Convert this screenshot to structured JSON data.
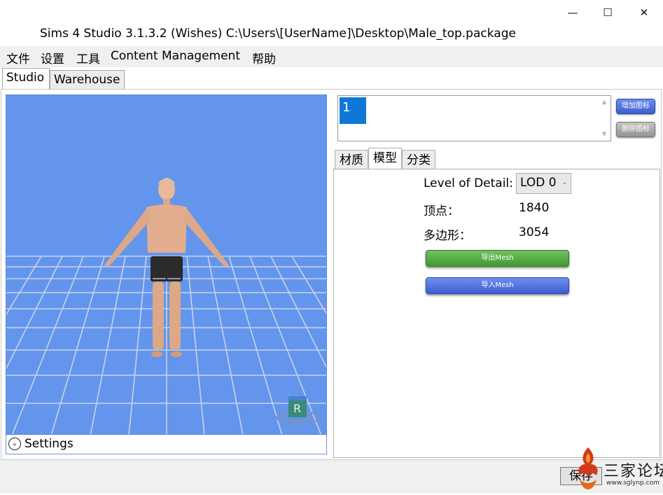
{
  "window": {
    "title": "Sims 4 Studio 3.1.3.2 (Wishes)  C:\\Users\\[UserName]\\Desktop\\Male_top.package",
    "controls": {
      "minimize": "—",
      "maximize": "☐",
      "close": "✕"
    }
  },
  "menu": {
    "items": [
      "文件",
      "设置",
      "工具",
      "Content Management",
      "帮助"
    ]
  },
  "main_tabs": [
    "Studio",
    "Warehouse"
  ],
  "viewport": {
    "settings_label": "Settings",
    "badge_letter": "R",
    "background_color": "#6495ed"
  },
  "icons_panel": {
    "items": [
      "1"
    ],
    "add_button": "增加图标",
    "delete_button": "删除图标"
  },
  "sub_tabs": [
    "材质",
    "模型",
    "分类"
  ],
  "model": {
    "lod_label": "Level of Detail:",
    "lod_value": "LOD 0",
    "vertices_label": "顶点：",
    "vertices_value": "1840",
    "polygons_label": "多边形：",
    "polygons_value": "3054",
    "export_button": "导出Mesh",
    "import_button": "导入Mesh"
  },
  "footer": {
    "save_button": "保存"
  },
  "watermark": {
    "text": "三家论坛",
    "url": "www.sglynp.com"
  }
}
